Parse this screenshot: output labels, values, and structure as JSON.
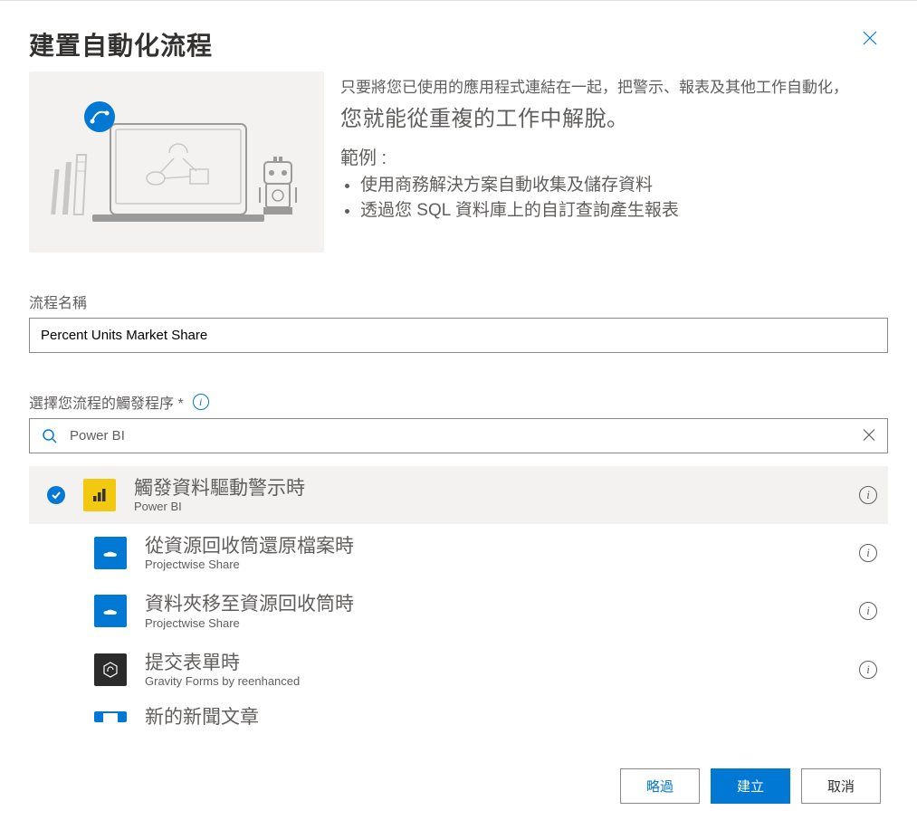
{
  "dialog": {
    "title": "建置自動化流程",
    "close_label": "Close"
  },
  "intro": {
    "lead": "只要將您已使用的應用程式連結在一起，把警示、報表及其他工作自動化，",
    "big": "您就能從重複的工作中解脫。",
    "example_label": "範例 :",
    "examples": [
      "使用商務解決方案自動收集及儲存資料",
      "透過您 SQL 資料庫上的自訂查詢產生報表"
    ]
  },
  "flow_name": {
    "label": "流程名稱",
    "value": "Percent Units Market Share"
  },
  "trigger": {
    "label": "選擇您流程的觸發程序 *",
    "info_tooltip": "info"
  },
  "search": {
    "value": "Power BI",
    "placeholder": ""
  },
  "triggers": [
    {
      "title": "觸發資料驅動警示時",
      "sub": "Power BI",
      "icon": "powerbi",
      "selected": true
    },
    {
      "title": "從資源回收筒還原檔案時",
      "sub": "Projectwise Share",
      "icon": "projectwise",
      "selected": false
    },
    {
      "title": "資料夾移至資源回收筒時",
      "sub": "Projectwise Share",
      "icon": "projectwise",
      "selected": false
    },
    {
      "title": "提交表單時",
      "sub": "Gravity Forms by reenhanced",
      "icon": "gravity",
      "selected": false
    },
    {
      "title": "新的新聞文章",
      "sub": "",
      "icon": "projectwise",
      "selected": false
    }
  ],
  "footer": {
    "skip": "略過",
    "create": "建立",
    "cancel": "取消"
  }
}
